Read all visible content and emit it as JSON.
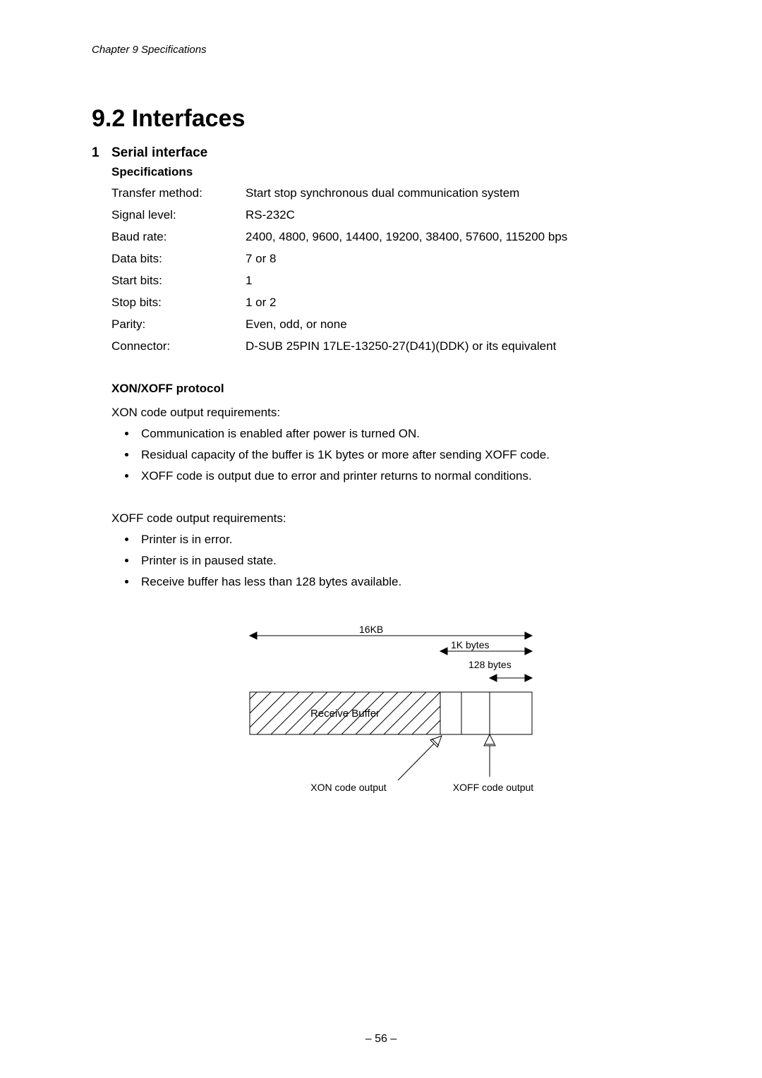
{
  "running_head": "Chapter 9   Specifications",
  "heading": "9.2   Interfaces",
  "section1": {
    "num": "1",
    "title": "Serial interface",
    "spec_heading": "Specifications",
    "specs": [
      {
        "label": "Transfer method:",
        "value": "Start stop synchronous dual communication system"
      },
      {
        "label": "Signal level:",
        "value": "RS-232C"
      },
      {
        "label": "Baud rate:",
        "value": "2400, 4800, 9600, 14400, 19200, 38400, 57600, 115200 bps"
      },
      {
        "label": "Data bits:",
        "value": "7 or 8"
      },
      {
        "label": "Start bits:",
        "value": "1"
      },
      {
        "label": "Stop bits:",
        "value": "1 or 2"
      },
      {
        "label": "Parity:",
        "value": "Even, odd, or none"
      },
      {
        "label": "Connector:",
        "value": "D-SUB 25PIN 17LE-13250-27(D41)(DDK) or its equivalent"
      }
    ],
    "proto_heading": "XON/XOFF protocol",
    "xon_intro": "XON code output requirements:",
    "xon_items": [
      "Communication is enabled after power is turned ON.",
      "Residual capacity of the buffer is 1K bytes or more after sending XOFF code.",
      "XOFF code is output due to error and printer returns to normal conditions."
    ],
    "xoff_intro": "XOFF code output requirements:",
    "xoff_items": [
      "Printer is in error.",
      "Printer is in paused state.",
      "Receive buffer has less than 128 bytes available."
    ]
  },
  "diagram": {
    "total_label": "16KB",
    "mid_label": "1K bytes",
    "small_label": "128 bytes",
    "buffer_label": "Receive Buffer",
    "xon_caption": "XON code output",
    "xoff_caption": "XOFF code output"
  },
  "chart_data": {
    "type": "diagram",
    "title": "Receive buffer thresholds for XON/XOFF flow control",
    "buffer_total_bytes": 16384,
    "xon_threshold_bytes": 1024,
    "xoff_threshold_bytes": 128,
    "annotations": [
      {
        "label": "16KB",
        "meaning": "total receive buffer size"
      },
      {
        "label": "1K bytes",
        "meaning": "free space at/above which XON is output"
      },
      {
        "label": "128 bytes",
        "meaning": "free space below which XOFF is output"
      }
    ]
  },
  "page_number": "– 56 –"
}
